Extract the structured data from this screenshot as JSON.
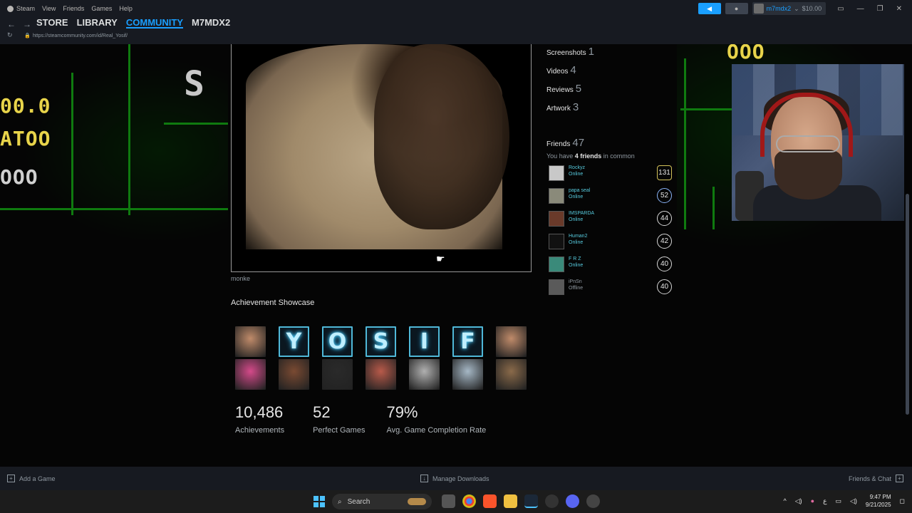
{
  "menubar": {
    "items": [
      "Steam",
      "View",
      "Friends",
      "Games",
      "Help"
    ],
    "account_name": "m7mdx2",
    "balance": "$10.00"
  },
  "nav": {
    "tabs": [
      "STORE",
      "LIBRARY",
      "COMMUNITY",
      "M7MDX2"
    ],
    "active_tab": "COMMUNITY",
    "url": "https://steamcommunity.com/id/Real_Yosif/"
  },
  "artwork": {
    "caption": "monke"
  },
  "showcase": {
    "title": "Achievement Showcase",
    "row1": [
      {
        "type": "photo",
        "label": "",
        "color": "#c08b6a"
      },
      {
        "type": "neon",
        "label": "Y"
      },
      {
        "type": "neon",
        "label": "O"
      },
      {
        "type": "neon",
        "label": "S"
      },
      {
        "type": "neon",
        "label": "I"
      },
      {
        "type": "neon",
        "label": "F"
      },
      {
        "type": "photo",
        "label": "",
        "color": "#c08b6a"
      }
    ],
    "row2": [
      {
        "type": "photo",
        "color": "#d44a8a"
      },
      {
        "type": "photo",
        "color": "#7a4a32"
      },
      {
        "type": "photo",
        "color": "#2a2a2a"
      },
      {
        "type": "photo",
        "color": "#b85a4a"
      },
      {
        "type": "photo",
        "color": "#b0b0b0"
      },
      {
        "type": "photo",
        "color": "#a6b8c6"
      },
      {
        "type": "photo",
        "color": "#8a6a4a"
      }
    ],
    "stats": [
      {
        "num": "10,486",
        "label": "Achievements"
      },
      {
        "num": "52",
        "label": "Perfect Games"
      },
      {
        "num": "79%",
        "label": "Avg. Game Completion Rate"
      }
    ]
  },
  "sidebar": {
    "counts": [
      {
        "label": "Screenshots",
        "count": "1"
      },
      {
        "label": "Videos",
        "count": "4"
      },
      {
        "label": "Reviews",
        "count": "5"
      },
      {
        "label": "Artwork",
        "count": "3"
      }
    ],
    "friends_label": "Friends",
    "friends_count": "47",
    "common_prefix": "You have",
    "common_count": "4 friends",
    "common_suffix": "in common",
    "friends": [
      {
        "name": "Rockyz",
        "status": "Online",
        "level": "131",
        "avatar_color": "#c8c8c8"
      },
      {
        "name": "papa seal",
        "status": "Online",
        "level": "52",
        "avatar_color": "#8a8a7a"
      },
      {
        "name": "IMSPARDA",
        "status": "Online",
        "level": "44",
        "avatar_color": "#6a3a2a"
      },
      {
        "name": "Human2",
        "status": "Online",
        "level": "42",
        "avatar_color": "#111111"
      },
      {
        "name": "F R Z",
        "status": "Online",
        "level": "40",
        "avatar_color": "#3a8a7a"
      },
      {
        "name": "iPnSn",
        "status": "Offline",
        "level": "40",
        "avatar_color": "#5a5a5a"
      }
    ]
  },
  "bottombar": {
    "add_game": "Add a Game",
    "manage_downloads": "Manage Downloads",
    "friends_chat": "Friends & Chat"
  },
  "taskbar": {
    "search_placeholder": "Search",
    "time": "9:47 PM",
    "date": "9/21/2025",
    "lang": "ع"
  }
}
